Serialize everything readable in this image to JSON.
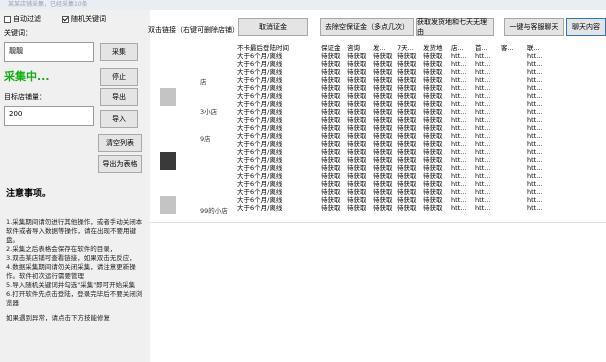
{
  "window": {
    "title": "某某店铺采集，已经采集10条"
  },
  "left": {
    "auto_filter": {
      "label": "自动过滤",
      "checked": false
    },
    "random_keyword": {
      "label": "随机关键词",
      "checked": true
    },
    "keyword_label": "关键词：",
    "keyword_value": "靓靓",
    "collect_btn": "采集",
    "status_text": "采集中...",
    "stop_btn": "停止",
    "target_label": "目标店铺量：",
    "export_btn": "导出",
    "target_value": "200",
    "import_btn": "导入",
    "clear_btn": "清空列表",
    "export_table_btn": "导出为表格",
    "notes_title": "注意事项。",
    "notes": [
      "1.采集期间请勿进行其他操作，或者手动关闭本软件或者导入数据等操作，请在出现不要用键盘。",
      "2.采集之后表格会保存在软件的目录，",
      "3.双击某店铺可查看链接，如果双击无反应，",
      "4.数据采集期间请勿关闭采集，请注意更新操作。软件初次运行需要管理",
      "5.导入随机关键词并勾选\"采集\"即可开始采集",
      "6.打开软件先点击登陆，登录完毕后不要关闭浏览器",
      "如果遇到异常，请点击下方技能修复"
    ]
  },
  "toolbar": {
    "hint": "双击链接（右键可删除店铺）",
    "remove_deposit": "取消证金",
    "remove_no_deposit": "去除空保证金（多点几次）",
    "get_seven_days": "获取发货地和七天无理由",
    "one_click_contact": "一键与客服聊天",
    "chat_content": "聊天内容"
  },
  "table": {
    "headers": [
      "",
      "不卡最后登陆时间",
      "保证金",
      "咨询",
      "发...",
      "7天...",
      "发货地",
      "店...",
      "首...",
      "客...",
      "联..."
    ],
    "rows": [
      [
        "",
        "大于6个月/离线",
        "待获取",
        "待获取",
        "待获取",
        "待获取",
        "待获取",
        "htt...",
        "htt...",
        "",
        "htt..."
      ],
      [
        "",
        "大于6个月/离线",
        "待获取",
        "待获取",
        "待获取",
        "待获取",
        "待获取",
        "htt...",
        "htt...",
        "",
        "htt..."
      ],
      [
        "",
        "大于6个月/离线",
        "待获取",
        "待获取",
        "待获取",
        "待获取",
        "待获取",
        "htt...",
        "htt...",
        "",
        "htt..."
      ],
      [
        "",
        "大于6个月/离线",
        "待获取",
        "待获取",
        "待获取",
        "待获取",
        "待获取",
        "htt...",
        "htt...",
        "",
        "htt..."
      ],
      [
        "",
        "大于6个月/离线",
        "待获取",
        "待获取",
        "待获取",
        "待获取",
        "待获取",
        "htt...",
        "htt...",
        "",
        "htt..."
      ],
      [
        "",
        "大于6个月/离线",
        "待获取",
        "待获取",
        "待获取",
        "待获取",
        "待获取",
        "htt...",
        "htt...",
        "",
        "htt..."
      ],
      [
        "",
        "大于6个月/离线",
        "待获取",
        "待获取",
        "待获取",
        "待获取",
        "待获取",
        "htt...",
        "htt...",
        "",
        "htt..."
      ],
      [
        "",
        "大于6个月/离线",
        "待获取",
        "待获取",
        "待获取",
        "待获取",
        "待获取",
        "htt...",
        "htt...",
        "",
        "htt..."
      ],
      [
        "",
        "大于6个月/离线",
        "待获取",
        "待获取",
        "待获取",
        "待获取",
        "待获取",
        "htt...",
        "htt...",
        "",
        "htt..."
      ],
      [
        "",
        "大于6个月/离线",
        "待获取",
        "待获取",
        "待获取",
        "待获取",
        "待获取",
        "htt...",
        "htt...",
        "",
        "htt..."
      ],
      [
        "",
        "大于6个月/离线",
        "待获取",
        "待获取",
        "待获取",
        "待获取",
        "待获取",
        "htt...",
        "htt...",
        "",
        "htt..."
      ],
      [
        "",
        "大于6个月/离线",
        "待获取",
        "待获取",
        "待获取",
        "待获取",
        "待获取",
        "htt...",
        "htt...",
        "",
        "htt..."
      ],
      [
        "",
        "大于6个月/离线",
        "待获取",
        "待获取",
        "待获取",
        "待获取",
        "待获取",
        "htt...",
        "htt...",
        "",
        "htt..."
      ],
      [
        "",
        "大于6个月/离线",
        "待获取",
        "待获取",
        "待获取",
        "待获取",
        "待获取",
        "htt...",
        "htt...",
        "",
        "htt..."
      ],
      [
        "",
        "大于6个月/离线",
        "待获取",
        "待获取",
        "待获取",
        "待获取",
        "待获取",
        "htt...",
        "htt...",
        "",
        "htt..."
      ],
      [
        "",
        "大于6个月/离线",
        "待获取",
        "待获取",
        "待获取",
        "待获取",
        "待获取",
        "htt...",
        "htt...",
        "",
        "htt..."
      ],
      [
        "",
        "大于6个月/离线",
        "待获取",
        "待获取",
        "待获取",
        "待获取",
        "待获取",
        "htt...",
        "htt...",
        "",
        "htt..."
      ],
      [
        "",
        "大于6个月/离线",
        "待获取",
        "待获取",
        "待获取",
        "待获取",
        "待获取",
        "htt...",
        "htt...",
        "",
        "htt..."
      ],
      [
        "",
        "大于6个月/离线",
        "待获取",
        "待获取",
        "待获取",
        "待获取",
        "待获取",
        "htt...",
        "htt...",
        "",
        "htt..."
      ],
      [
        "",
        "大于6个月/离线",
        "待获取",
        "待获取",
        "待获取",
        "待获取",
        "待获取",
        "htt...",
        "htt...",
        "",
        "htt..."
      ]
    ],
    "shop_fragments": [
      "店",
      "3小店",
      "9店",
      "99的小店"
    ]
  }
}
